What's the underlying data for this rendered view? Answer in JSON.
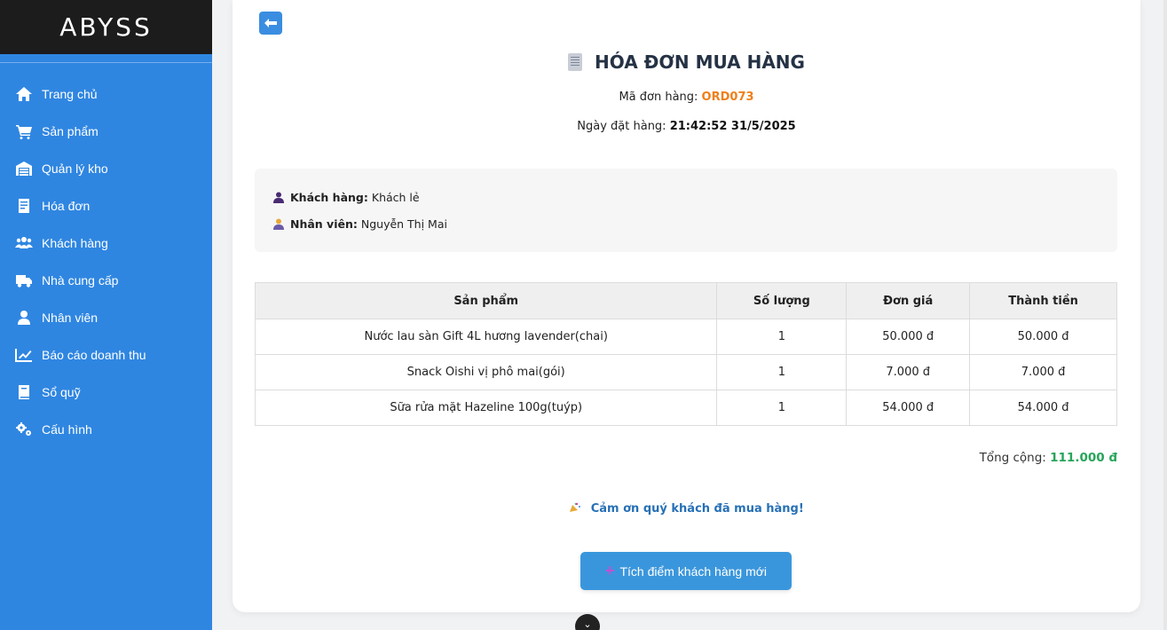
{
  "app": {
    "logo": "ABYSS"
  },
  "sidebar": {
    "items": [
      {
        "label": "Trang chủ",
        "icon": "home-icon"
      },
      {
        "label": "Sản phẩm",
        "icon": "cart-icon"
      },
      {
        "label": "Quản lý kho",
        "icon": "warehouse-icon"
      },
      {
        "label": "Hóa đơn",
        "icon": "invoice-icon"
      },
      {
        "label": "Khách hàng",
        "icon": "users-icon"
      },
      {
        "label": "Nhà cung cấp",
        "icon": "truck-icon"
      },
      {
        "label": "Nhân viên",
        "icon": "user-icon"
      },
      {
        "label": "Báo cáo doanh thu",
        "icon": "chart-line-icon"
      },
      {
        "label": "Sổ quỹ",
        "icon": "book-icon"
      },
      {
        "label": "Cấu hình",
        "icon": "gears-icon"
      }
    ]
  },
  "invoice": {
    "title": "HÓA ĐƠN MUA HÀNG",
    "order_code_label": "Mã đơn hàng:",
    "order_code": "ORD073",
    "order_date_label": "Ngày đặt hàng:",
    "order_date": "21:42:52 31/5/2025",
    "customer_label": "Khách hàng:",
    "customer": "Khách lẻ",
    "staff_label": "Nhân viên:",
    "staff": "Nguyễn Thị Mai",
    "columns": [
      "Sản phẩm",
      "Số lượng",
      "Đơn giá",
      "Thành tiền"
    ],
    "rows": [
      [
        "Nước lau sàn Gift 4L hương lavender(chai)",
        "1",
        "50.000 đ",
        "50.000 đ"
      ],
      [
        "Snack Oishi vị phô mai(gói)",
        "1",
        "7.000 đ",
        "7.000 đ"
      ],
      [
        "Sữa rửa mặt Hazeline 100g(tuýp)",
        "1",
        "54.000 đ",
        "54.000 đ"
      ]
    ],
    "total_label": "Tổng cộng:",
    "total": "111.000 đ",
    "thanks": "Cảm ơn quý khách đã mua hàng!",
    "action_label": "Tích điểm khách hàng mới"
  },
  "colors": {
    "sidebar": "#2f86e1",
    "logo_bar": "#1c1c1c",
    "order_code": "#ef7f1a",
    "total": "#27a55a",
    "thanks": "#2770b6",
    "button": "#3a96dc"
  }
}
